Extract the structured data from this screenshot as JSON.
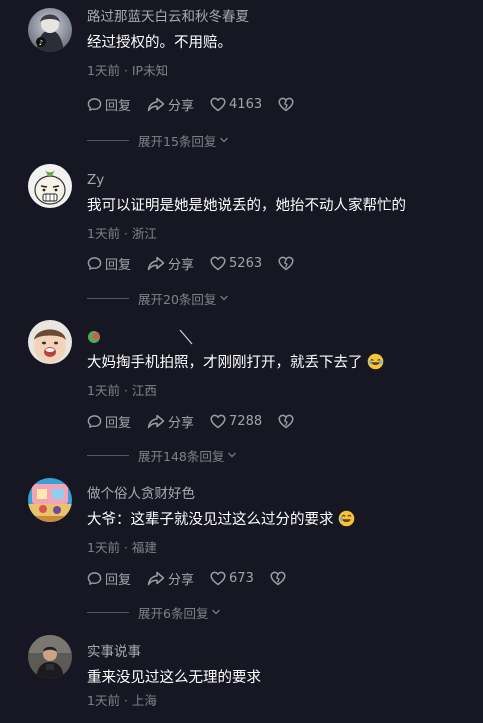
{
  "colors": {
    "background": "#161722",
    "text_primary": "#ffffff",
    "text_secondary": "#9b9ca3",
    "text_muted": "#74757c"
  },
  "comments": [
    {
      "username": "路过那蓝天白云和秋冬春夏",
      "content": "经过授权的。不用赔。",
      "meta": "1天前 · IP未知",
      "reply_label": "回复",
      "share_label": "分享",
      "likes": "4163",
      "expand_label": "展开15条回复"
    },
    {
      "username": "Zy",
      "content": "我可以证明是她是她说丢的，她抬不动人家帮忙的",
      "meta": "1天前 · 浙江",
      "reply_label": "回复",
      "share_label": "分享",
      "likes": "5263",
      "expand_label": "展开20条回复"
    },
    {
      "username": "",
      "content": "大妈掏手机拍照，才刚刚打开，就丢下去了",
      "meta": "1天前 · 江西",
      "reply_label": "回复",
      "share_label": "分享",
      "likes": "7288",
      "expand_label": "展开148条回复"
    },
    {
      "username": "做个俗人贪财好色",
      "content": "大爷：这辈子就没见过这么过分的要求",
      "meta": "1天前 · 福建",
      "reply_label": "回复",
      "share_label": "分享",
      "likes": "673",
      "expand_label": "展开6条回复"
    },
    {
      "username": "实事说事",
      "content": "重来没见过这么无理的要求",
      "meta": "1天前 · 上海"
    }
  ]
}
